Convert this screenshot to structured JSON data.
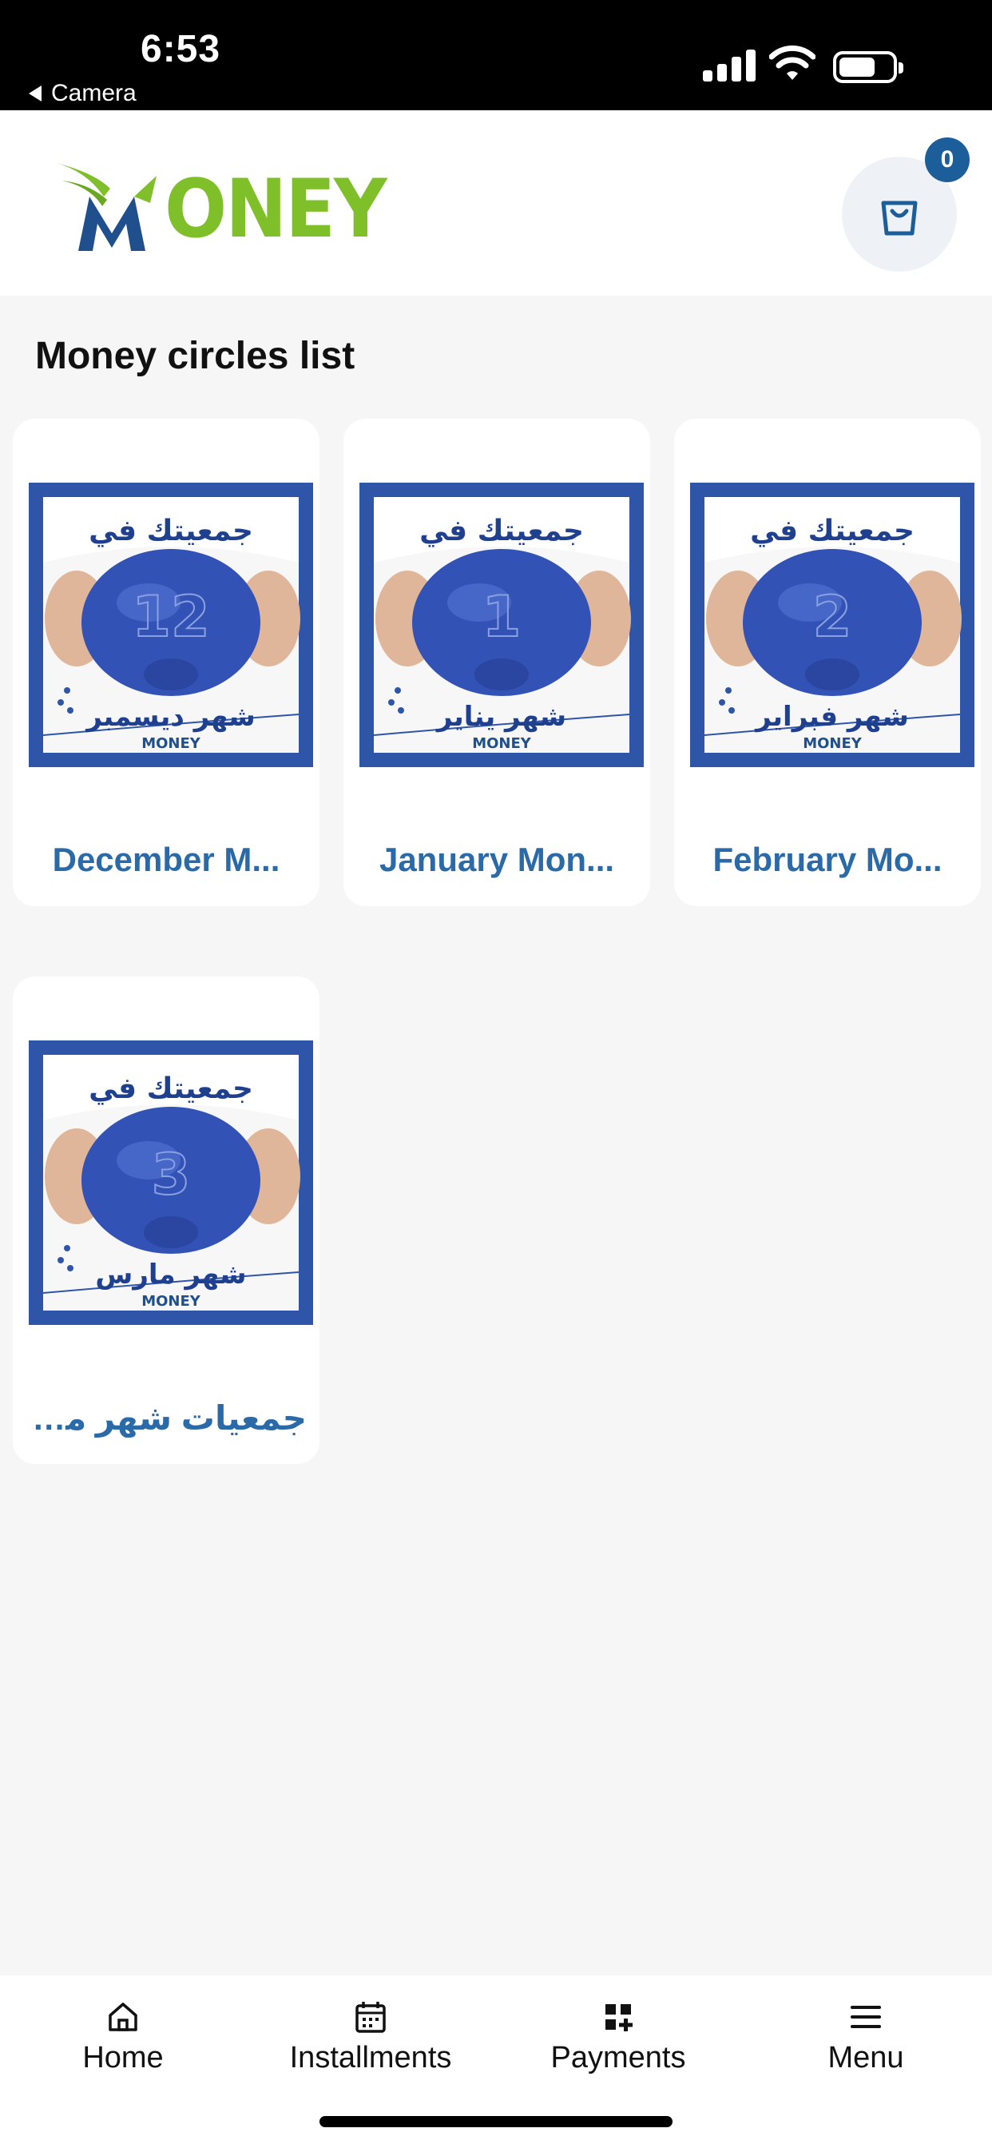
{
  "status_bar": {
    "time": "6:53",
    "back_label": "Camera",
    "icons": [
      "cellular-signal-icon",
      "wifi-icon",
      "battery-icon"
    ]
  },
  "header": {
    "logo_text": "ONEY",
    "cart_count": "0",
    "cart_icon": "shopping-bag-icon"
  },
  "page_title": "Money circles list",
  "cards": [
    {
      "title": "December M...",
      "image": {
        "heading": "جمعيتك في",
        "number": "12",
        "month": "شهر ديسمبر",
        "brand": "MONEY"
      }
    },
    {
      "title": "January Mon...",
      "image": {
        "heading": "جمعيتك في",
        "number": "1",
        "month": "شهر يناير",
        "brand": "MONEY"
      }
    },
    {
      "title": "February Mo...",
      "image": {
        "heading": "جمعيتك في",
        "number": "2",
        "month": "شهر فبراير",
        "brand": "MONEY"
      }
    },
    {
      "title": "جمعيات شهر مار...",
      "image": {
        "heading": "جمعيتك في",
        "number": "3",
        "month": "شهر مارس",
        "brand": "MONEY"
      }
    }
  ],
  "bottom_nav": [
    {
      "label": "Home",
      "icon": "home-icon"
    },
    {
      "label": "Installments",
      "icon": "calendar-icon"
    },
    {
      "label": "Payments",
      "icon": "grid-plus-icon"
    },
    {
      "label": "Menu",
      "icon": "menu-icon"
    }
  ],
  "colors": {
    "accent": "#1c5e9a",
    "card_title": "#2a6aa8",
    "logo_green": "#7fbf2a",
    "logo_blue": "#1f4f8c",
    "background": "#f6f6f7"
  }
}
